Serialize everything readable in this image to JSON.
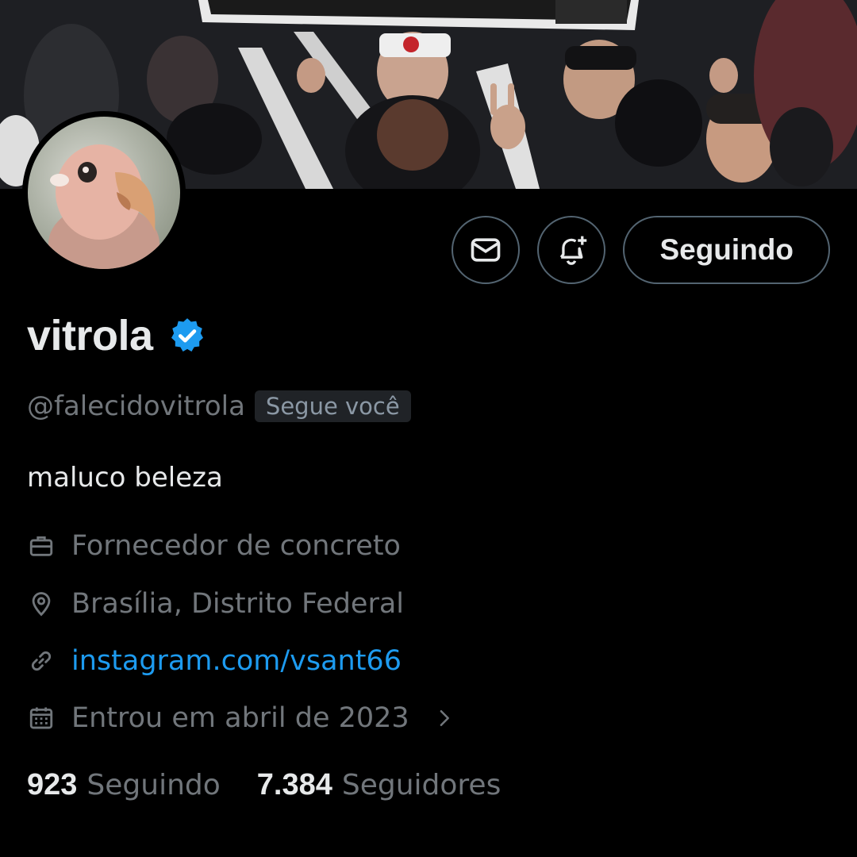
{
  "profile": {
    "display_name": "vitrola",
    "handle": "@falecidovitrola",
    "follows_you_badge": "Segue você",
    "bio": "maluco beleza"
  },
  "actions": {
    "follow_label": "Seguindo"
  },
  "meta": {
    "profession": "Fornecedor de concreto",
    "location": "Brasília, Distrito Federal",
    "website": "instagram.com/vsant66",
    "joined": "Entrou em abril de 2023"
  },
  "stats": {
    "following_count": "923",
    "following_label": "Seguindo",
    "followers_count": "7.384",
    "followers_label": "Seguidores"
  },
  "colors": {
    "background": "#000000",
    "text_primary": "#e7e9ea",
    "text_secondary": "#71767b",
    "link": "#1d9bf0",
    "verified": "#1d9bf0",
    "border": "#536471"
  },
  "icons": [
    "message-icon",
    "notification-bell-icon",
    "verified-badge-icon",
    "briefcase-icon",
    "location-pin-icon",
    "link-icon",
    "calendar-icon",
    "chevron-right-icon"
  ]
}
